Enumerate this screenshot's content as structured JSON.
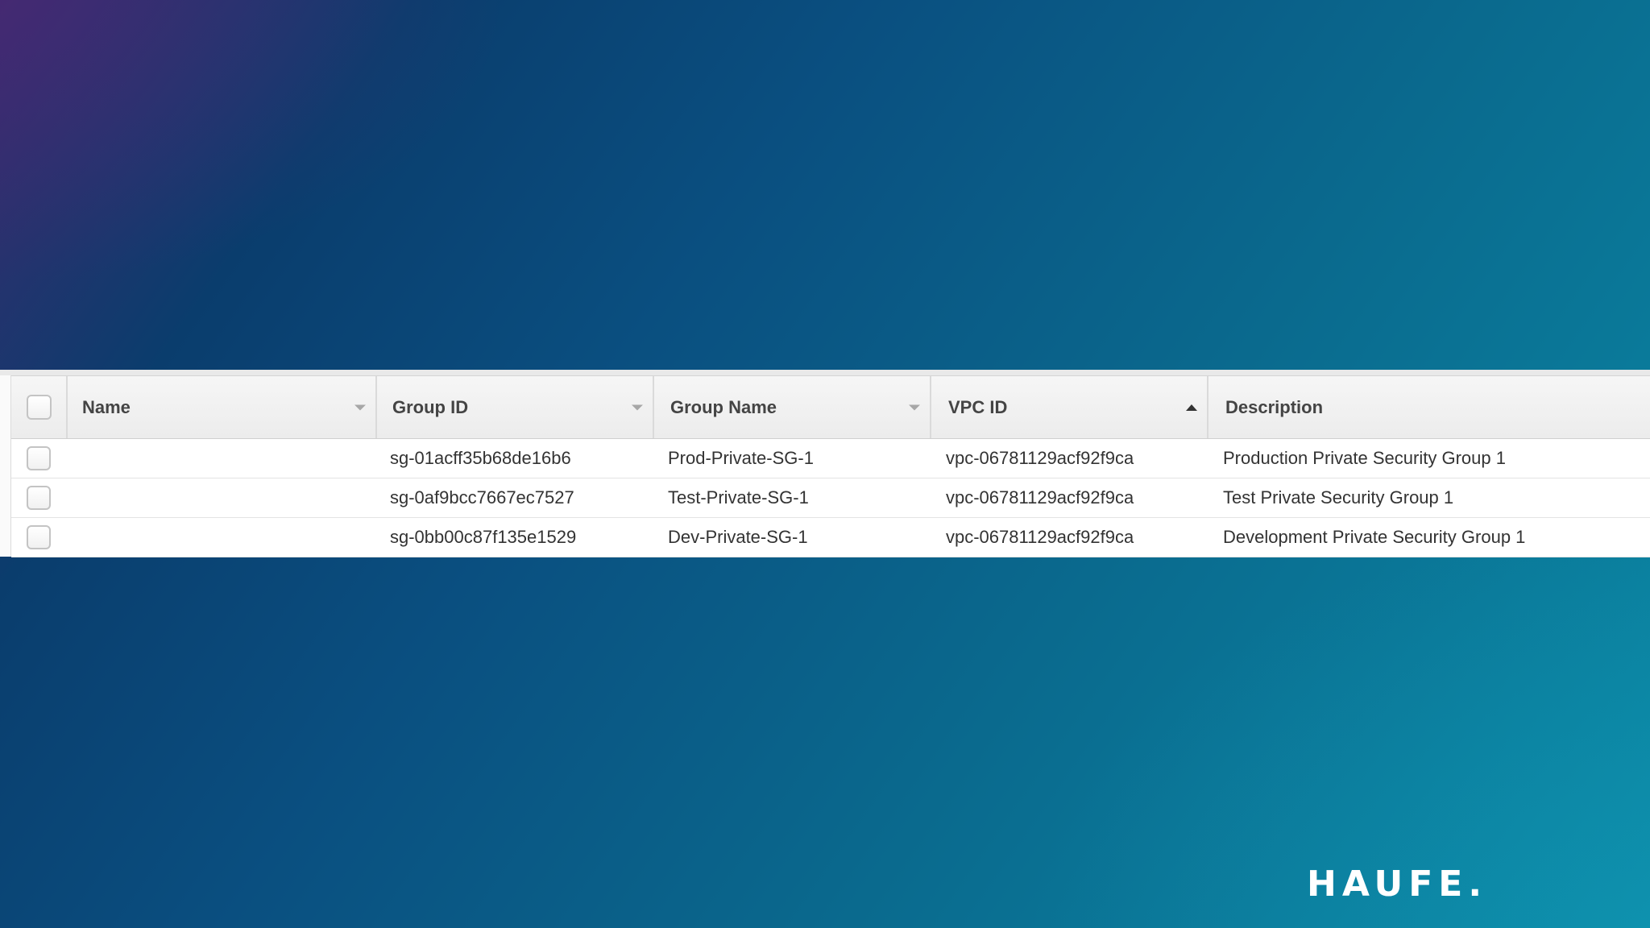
{
  "branding": {
    "logo_text": "HAUFE."
  },
  "table": {
    "columns": [
      {
        "label": "Name",
        "sort": "none"
      },
      {
        "label": "Group ID",
        "sort": "none"
      },
      {
        "label": "Group Name",
        "sort": "none"
      },
      {
        "label": "VPC ID",
        "sort": "ascending"
      },
      {
        "label": "Description",
        "sort": "none"
      }
    ],
    "rows": [
      {
        "name": "",
        "group_id": "sg-01acff35b68de16b6",
        "group_name": "Prod-Private-SG-1",
        "vpc_id": "vpc-06781129acf92f9ca",
        "description": "Production Private Security Group 1"
      },
      {
        "name": "",
        "group_id": "sg-0af9bcc7667ec7527",
        "group_name": "Test-Private-SG-1",
        "vpc_id": "vpc-06781129acf92f9ca",
        "description": "Test Private Security Group 1"
      },
      {
        "name": "",
        "group_id": "sg-0bb00c87f135e1529",
        "group_name": "Dev-Private-SG-1",
        "vpc_id": "vpc-06781129acf92f9ca",
        "description": "Development Private Security Group 1"
      }
    ]
  },
  "colors": {
    "background_start": "#3b2a6e",
    "background_mid": "#0a4f80",
    "background_end": "#0b8aa6",
    "header_bg": "#efefef",
    "row_bg": "#ffffff",
    "text": "#333333",
    "logo": "#ffffff"
  },
  "icons": {
    "sort_default": "caret-down-icon",
    "sort_active": "caret-up-icon"
  }
}
